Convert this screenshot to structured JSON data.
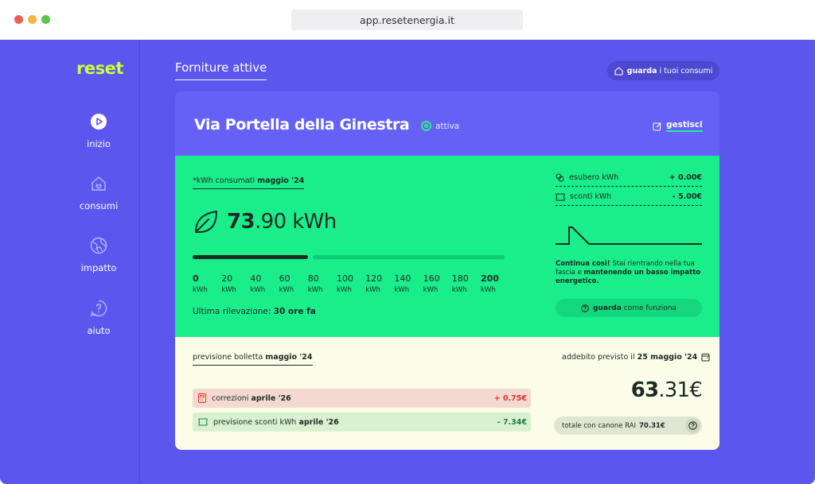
{
  "browser": {
    "url": "app.resetenergia.it"
  },
  "brand": {
    "logo": "reset",
    "logo_color": "#c8ff3c",
    "bg_color": "#5b57ee",
    "accent_green": "#19ee8a"
  },
  "sidebar": {
    "items": [
      {
        "label": "inizio",
        "icon": "play-icon"
      },
      {
        "label": "consumi",
        "icon": "home-plug-icon"
      },
      {
        "label": "impatto",
        "icon": "globe-icon"
      },
      {
        "label": "aiuto",
        "icon": "help-icon"
      }
    ]
  },
  "header": {
    "title": "Forniture attive",
    "consumi_button": {
      "bold": "guarda",
      "rest": "i tuoi consumi"
    }
  },
  "supply": {
    "address": "Via Portella della Ginestra",
    "status": "attiva",
    "manage_label": "gestisci"
  },
  "consumption": {
    "label_prefix": "*kWh consumati",
    "label_month": "maggio '24",
    "value_int": "73",
    "value_dec": ".90",
    "unit": "kWh",
    "value": 73.9,
    "scale_max": 200,
    "scale": [
      {
        "v": "0",
        "u": "kWh",
        "bold": true
      },
      {
        "v": "20",
        "u": "kWh",
        "bold": false
      },
      {
        "v": "40",
        "u": "kWh",
        "bold": false
      },
      {
        "v": "60",
        "u": "kWh",
        "bold": false
      },
      {
        "v": "80",
        "u": "kWh",
        "bold": false
      },
      {
        "v": "100",
        "u": "kWh",
        "bold": false
      },
      {
        "v": "120",
        "u": "kWh",
        "bold": false
      },
      {
        "v": "140",
        "u": "kWh",
        "bold": false
      },
      {
        "v": "160",
        "u": "kWh",
        "bold": false
      },
      {
        "v": "180",
        "u": "kWh",
        "bold": false
      },
      {
        "v": "200",
        "u": "kWh",
        "bold": true
      }
    ],
    "last_reading_label": "Ultima rilevazione:",
    "last_reading_value": "30 ore fa"
  },
  "side": {
    "esubero_label": "esubero kWh",
    "esubero_value": "+ 0.00€",
    "sconti_label": "sconti kWh",
    "sconti_value": "- 5.00€",
    "advice_bold": "Continua così!",
    "advice_text": " Stai rientrando nella tua fascia e ",
    "advice_bold2": "mantenendo un basso impatto energetico.",
    "come_button_bold": "guarda",
    "come_button_rest": "come funziona"
  },
  "bill": {
    "label_prefix": "previsione bolletta",
    "label_month": "maggio '24",
    "addebito_prefix": "addebito previsto il",
    "addebito_date": "25 maggio '24",
    "items": [
      {
        "label": "correzioni",
        "month": "aprile '26",
        "value": "+ 0.75€"
      },
      {
        "label": "previsione sconti kWh",
        "month": "aprile '26",
        "value": "- 7.34€"
      }
    ],
    "total_int": "63",
    "total_dec": ".31€",
    "canone_label": "totale con canone RAI",
    "canone_value": "70.31€"
  }
}
